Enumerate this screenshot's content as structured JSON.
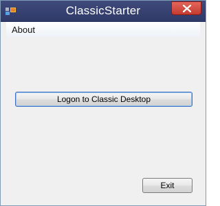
{
  "window": {
    "title": "ClassicStarter",
    "app_icon": "windows-app-icon",
    "close_icon": "close-icon"
  },
  "menubar": {
    "items": [
      {
        "label": "About"
      }
    ]
  },
  "buttons": {
    "logon_label": "Logon to Classic Desktop",
    "exit_label": "Exit"
  },
  "colors": {
    "titlebar": "#2f3a69",
    "close_button": "#c43b2f",
    "client_background": "#f0f0f0"
  }
}
